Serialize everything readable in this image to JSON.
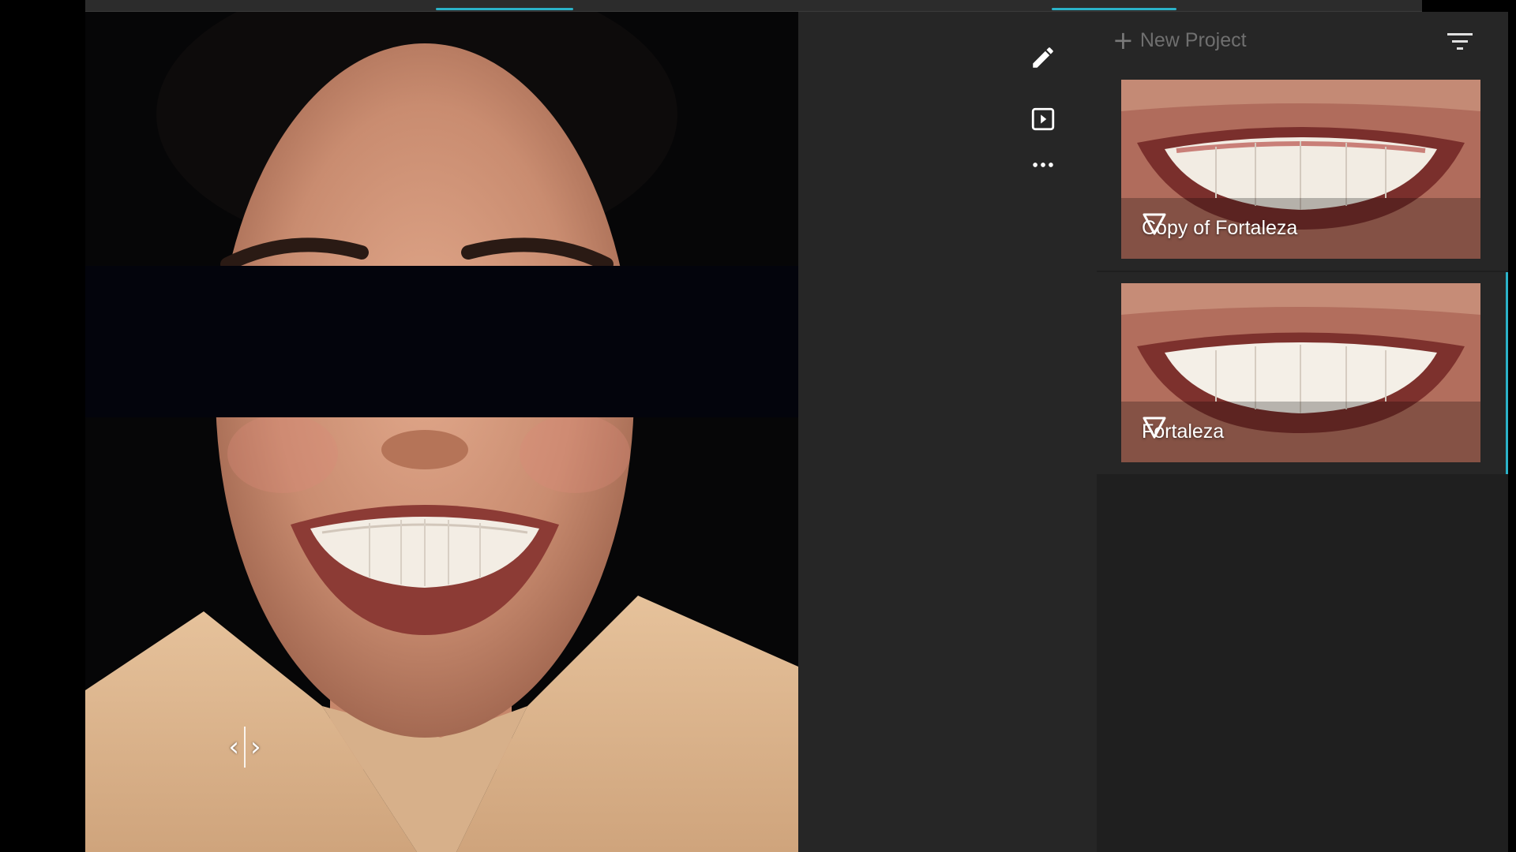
{
  "panel": {
    "new_project_label": "New Project",
    "projects": [
      {
        "name": "Copy of Fortaleza"
      },
      {
        "name": "Fortaleza"
      }
    ]
  },
  "viewer": {
    "compare_left": "‹",
    "compare_right": "›"
  },
  "icons": {
    "edit": "pencil-icon",
    "play": "play-square-icon",
    "more": "more-horizontal-icon",
    "filter": "filter-icon",
    "project": "triangle-down-outline-icon"
  },
  "colors": {
    "accent": "#2bb3c9",
    "background": "#242424",
    "panel": "#1f1f1f",
    "text_muted": "#6f6f6f"
  }
}
